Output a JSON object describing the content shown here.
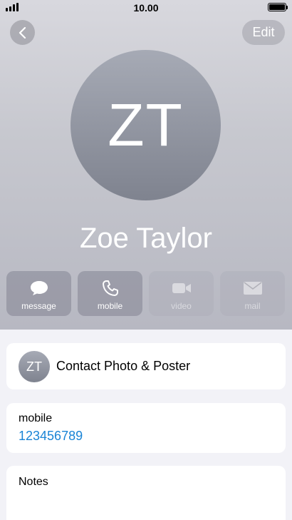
{
  "status_bar": {
    "time": "10.00"
  },
  "nav": {
    "edit_label": "Edit"
  },
  "contact": {
    "initials": "ZT",
    "name": "Zoe Taylor"
  },
  "actions": [
    {
      "label": "message",
      "icon": "message-bubble-icon",
      "enabled": true
    },
    {
      "label": "mobile",
      "icon": "phone-icon",
      "enabled": true
    },
    {
      "label": "video",
      "icon": "video-camera-icon",
      "enabled": false
    },
    {
      "label": "mail",
      "icon": "envelope-icon",
      "enabled": false
    }
  ],
  "photo_poster": {
    "label": "Contact Photo & Poster"
  },
  "phone": {
    "label": "mobile",
    "number": "123456789"
  },
  "notes": {
    "label": "Notes"
  },
  "colors": {
    "link": "#1a84d6",
    "background": "#f2f2f7"
  }
}
